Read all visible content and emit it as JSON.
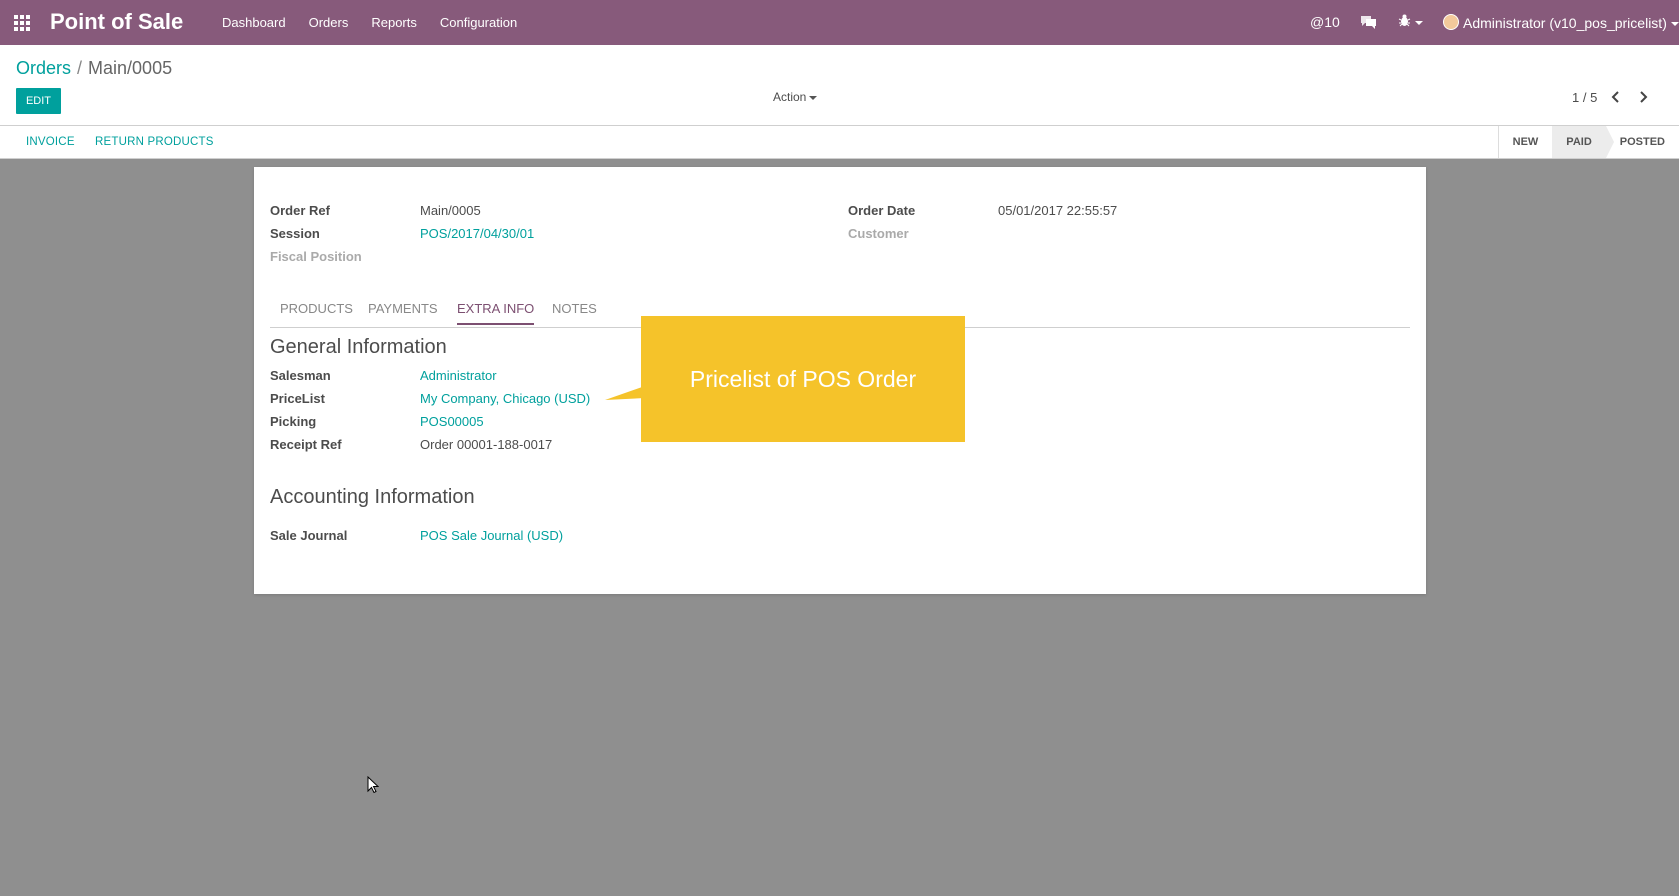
{
  "topbar": {
    "app_title": "Point of Sale",
    "menu": [
      "Dashboard",
      "Orders",
      "Reports",
      "Configuration"
    ],
    "mentions": "@10",
    "user": "Administrator (v10_pos_pricelist)",
    "accent_color": "#875A7B"
  },
  "control_panel": {
    "breadcrumb_parent": "Orders",
    "breadcrumb_separator": "/",
    "breadcrumb_current": "Main/0005",
    "edit_label": "EDIT",
    "action_label": "Action",
    "pager": "1 / 5"
  },
  "statusbar": {
    "invoice_label": "INVOICE",
    "return_label": "RETURN PRODUCTS",
    "stages": [
      "NEW",
      "PAID",
      "POSTED"
    ],
    "active_stage": "PAID"
  },
  "form": {
    "order_ref_label": "Order Ref",
    "order_ref": "Main/0005",
    "session_label": "Session",
    "session": "POS/2017/04/30/01",
    "fiscal_position_label": "Fiscal Position",
    "order_date_label": "Order Date",
    "order_date": "05/01/2017 22:55:57",
    "customer_label": "Customer",
    "tabs": [
      "PRODUCTS",
      "PAYMENTS",
      "EXTRA INFO",
      "NOTES"
    ],
    "active_tab": "EXTRA INFO",
    "general_title": "General Information",
    "salesman_label": "Salesman",
    "salesman": "Administrator",
    "pricelist_label": "PriceList",
    "pricelist": "My Company, Chicago (USD)",
    "picking_label": "Picking",
    "picking": "POS00005",
    "receipt_ref_label": "Receipt Ref",
    "receipt_ref": "Order 00001-188-0017",
    "accounting_title": "Accounting Information",
    "sale_journal_label": "Sale Journal",
    "sale_journal": "POS Sale Journal (USD)"
  },
  "callout": {
    "text": "Pricelist of POS Order",
    "color": "#F5C32A"
  },
  "icons": [
    "apps-grid-icon",
    "at-icon",
    "chat-icon",
    "bug-icon",
    "avatar",
    "chevron-left-icon",
    "chevron-right-icon",
    "mouse-cursor-icon"
  ]
}
